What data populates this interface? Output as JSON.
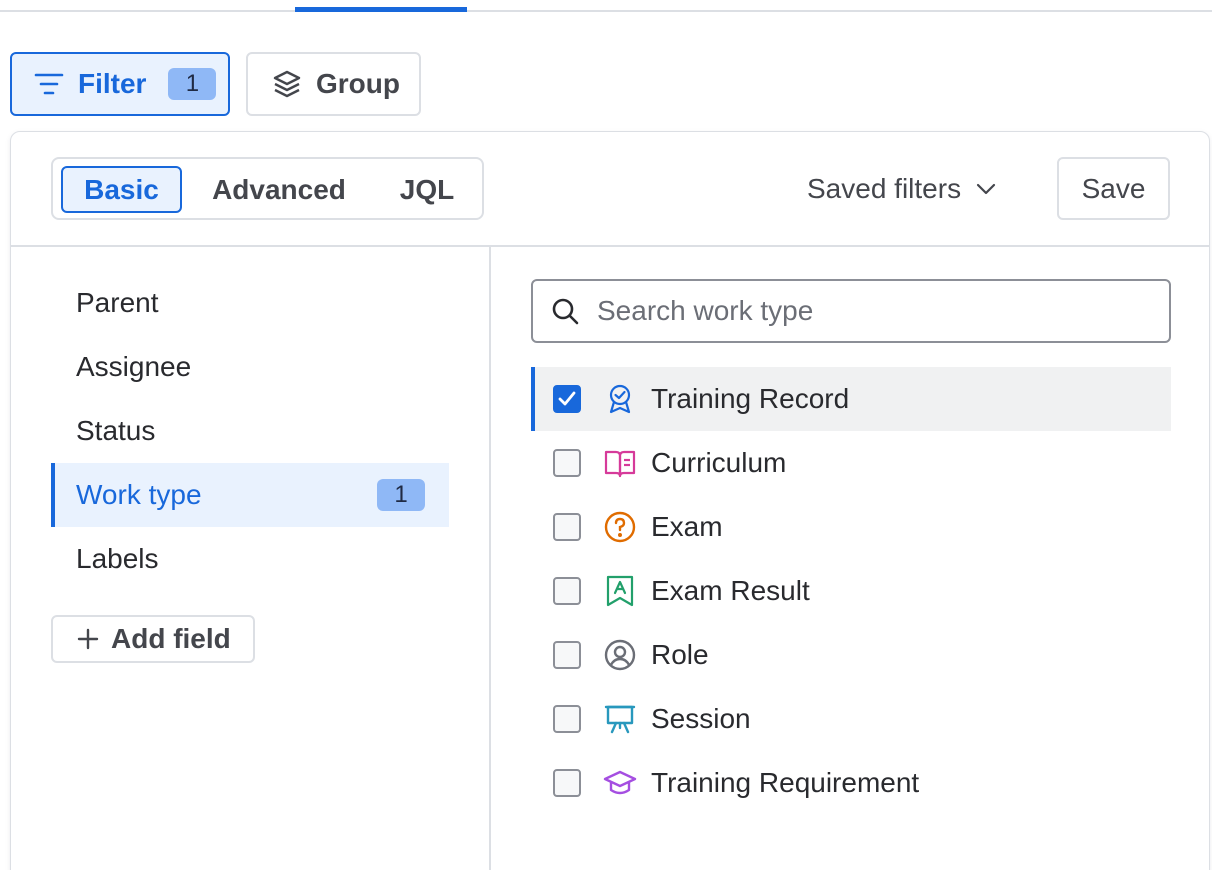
{
  "toolbar": {
    "filter_label": "Filter",
    "filter_count": "1",
    "group_label": "Group"
  },
  "modes": {
    "basic": "Basic",
    "advanced": "Advanced",
    "jql": "JQL",
    "selected": "Basic"
  },
  "header": {
    "saved_filters_label": "Saved filters",
    "save_label": "Save"
  },
  "fields": [
    {
      "label": "Parent"
    },
    {
      "label": "Assignee"
    },
    {
      "label": "Status"
    },
    {
      "label": "Work type",
      "count": "1",
      "active": true
    },
    {
      "label": "Labels"
    }
  ],
  "add_field_label": "Add field",
  "search": {
    "placeholder": "Search work type",
    "value": ""
  },
  "options": [
    {
      "label": "Training Record",
      "checked": true,
      "icon": "ribbon-badge-icon",
      "color": "#1868db"
    },
    {
      "label": "Curriculum",
      "checked": false,
      "icon": "book-icon",
      "color": "#d63a9a"
    },
    {
      "label": "Exam",
      "checked": false,
      "icon": "question-circle-icon",
      "color": "#e06c00"
    },
    {
      "label": "Exam Result",
      "checked": false,
      "icon": "bookmark-a-icon",
      "color": "#22a06b"
    },
    {
      "label": "Role",
      "checked": false,
      "icon": "person-circle-icon",
      "color": "#6b6e76"
    },
    {
      "label": "Session",
      "checked": false,
      "icon": "presentation-icon",
      "color": "#2898bd"
    },
    {
      "label": "Training Requirement",
      "checked": false,
      "icon": "graduation-cap-icon",
      "color": "#a54ee1"
    }
  ],
  "colors": {
    "accent": "#1868db",
    "selected_bg": "#e9f2fe",
    "border": "#dcdfe4",
    "badge": "#8fb8f6"
  }
}
